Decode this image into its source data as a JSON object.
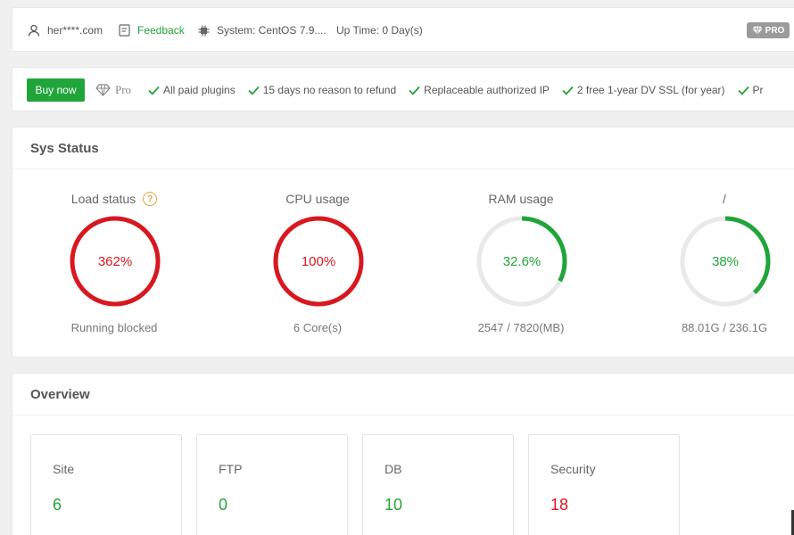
{
  "topbar": {
    "user": "her****.com",
    "feedback": "Feedback",
    "system": "System: CentOS 7.9....",
    "uptime": "Up Time: 0 Day(s)",
    "pro_badge": "PRO"
  },
  "probar": {
    "buy_label": "Buy now",
    "pro_label": "Pro",
    "features": [
      "All paid plugins",
      "15 days no reason to refund",
      "Replaceable authorized IP",
      "2 free 1-year DV SSL (for year)",
      "Pr"
    ]
  },
  "sys_status": {
    "title": "Sys Status",
    "gauges": [
      {
        "label": "Load status",
        "value_text": "362%",
        "percent": 100,
        "sub": "Running blocked",
        "color": "#d9171f"
      },
      {
        "label": "CPU usage",
        "value_text": "100%",
        "percent": 100,
        "sub": "6 Core(s)",
        "color": "#d9171f"
      },
      {
        "label": "RAM usage",
        "value_text": "32.6%",
        "percent": 32.6,
        "sub": "2547 / 7820(MB)",
        "color": "#20a53a"
      },
      {
        "label": "/",
        "value_text": "38%",
        "percent": 38,
        "sub": "88.01G / 236.1G",
        "color": "#20a53a"
      }
    ]
  },
  "overview": {
    "title": "Overview",
    "cards": [
      {
        "name": "Site",
        "value": "6",
        "color": "#20a53a"
      },
      {
        "name": "FTP",
        "value": "0",
        "color": "#20a53a"
      },
      {
        "name": "DB",
        "value": "10",
        "color": "#20a53a"
      },
      {
        "name": "Security",
        "value": "18",
        "color": "#d9171f"
      }
    ]
  },
  "colors": {
    "accent": "#20a53a",
    "danger": "#d9171f",
    "track": "#e9e9e9",
    "warning": "#e6a23c"
  }
}
